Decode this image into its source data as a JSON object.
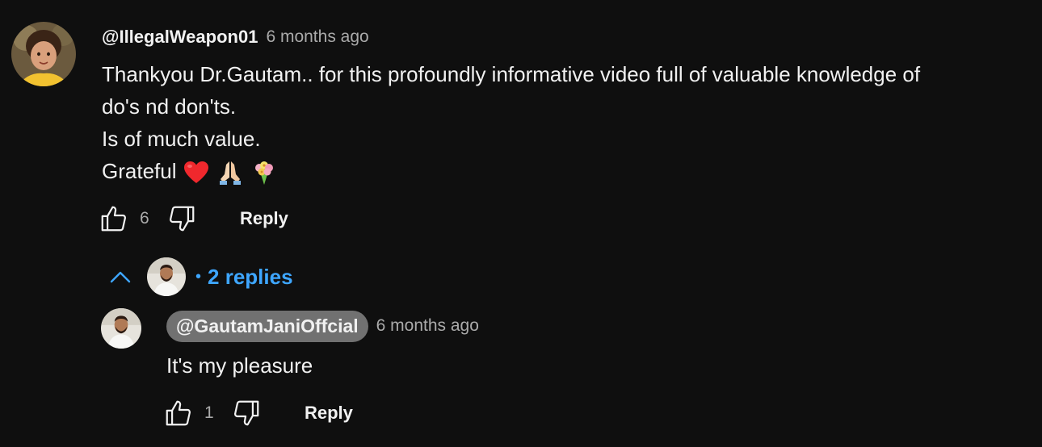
{
  "comment": {
    "author": "@IllegalWeapon01",
    "timestamp": "6 months ago",
    "lines": [
      "Thankyou Dr.Gautam.. for this profoundly informative video full of valuable knowledge of",
      "do's nd don'ts.",
      "Is of much value.",
      "Grateful"
    ],
    "emojis": [
      "red-heart-emoji",
      "folded-hands-emoji",
      "bouquet-emoji"
    ],
    "like_count": "6",
    "reply_label": "Reply",
    "avatar_icon": "girl-avatar"
  },
  "replies": {
    "toggle_icon": "chevron-up-icon",
    "separator": "•",
    "count_label": "2 replies"
  },
  "reply": {
    "author": "@GautamJaniOffcial",
    "timestamp": "6 months ago",
    "text": "It's my pleasure",
    "like_count": "1",
    "reply_label": "Reply",
    "avatar_icon": "man-avatar"
  },
  "colors": {
    "background": "#0f0f0f",
    "text": "#f1f1f1",
    "secondary_text": "#aaaaaa",
    "link_blue": "#3ea6ff",
    "owner_chip": "#717171"
  }
}
